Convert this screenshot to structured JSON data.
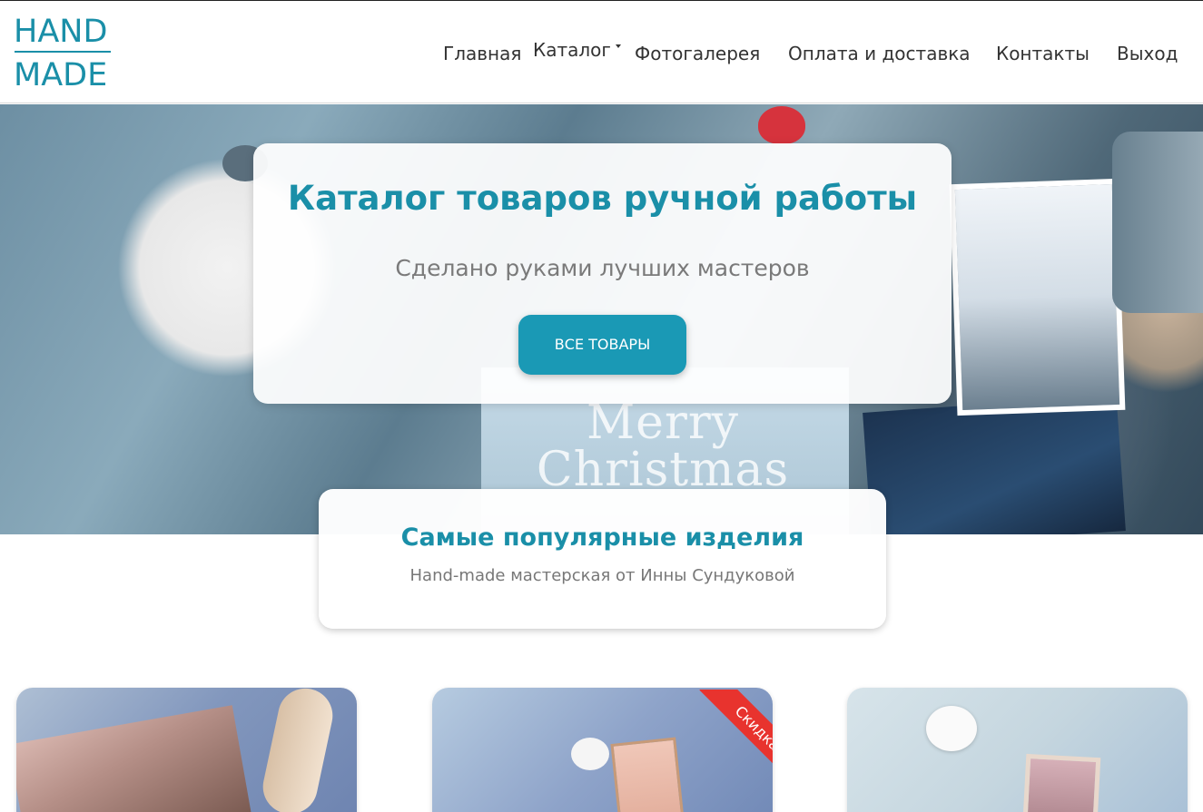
{
  "logo": {
    "line1": "HAND",
    "line2": "MADE"
  },
  "nav": {
    "items": [
      "Главная",
      "Каталог",
      "Фотогалерея",
      "Оплата и доставка",
      "Контакты",
      "Выход"
    ]
  },
  "hero": {
    "title": "Каталог товаров ручной работы",
    "subtitle": "Сделано руками лучших мастеров",
    "button": "ВСЕ ТОВАРЫ",
    "background_text": "Merry Christmas"
  },
  "popular": {
    "title": "Самые популярные изделия",
    "subtitle": "Hand-made мастерская от Инны Сундуковой"
  },
  "products": [
    {
      "badge": ""
    },
    {
      "badge": "Скидка"
    },
    {
      "badge": ""
    }
  ],
  "colors": {
    "accent": "#1a8fa8",
    "button": "#1a99b5",
    "sale": "#e8332e"
  }
}
